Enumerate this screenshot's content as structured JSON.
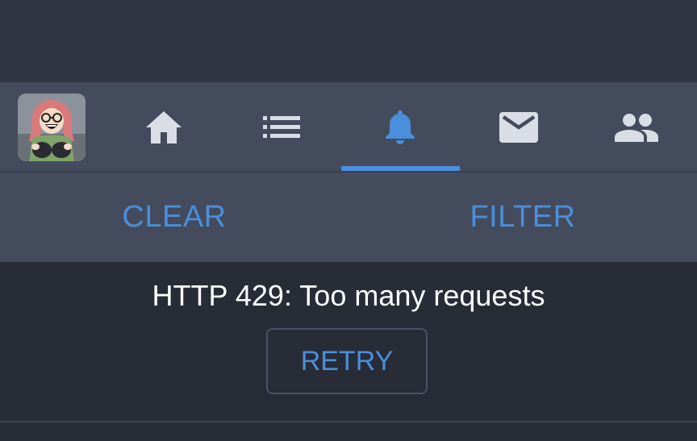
{
  "colors": {
    "accent": "#4a8fdb",
    "nav_background": "#444b5d",
    "page_background": "#282c37",
    "icon_default": "#d9dde6",
    "error_text": "#ffffff"
  },
  "navigation": {
    "active_tab": "notifications",
    "tabs": [
      {
        "id": "home",
        "icon": "home-icon",
        "active": false
      },
      {
        "id": "lists",
        "icon": "list-icon",
        "active": false
      },
      {
        "id": "notifications",
        "icon": "bell-icon",
        "active": true
      },
      {
        "id": "messages",
        "icon": "envelope-icon",
        "active": false
      },
      {
        "id": "people",
        "icon": "people-icon",
        "active": false
      }
    ]
  },
  "actions": {
    "clear_label": "CLEAR",
    "filter_label": "FILTER"
  },
  "error": {
    "message": "HTTP 429: Too many requests",
    "retry_label": "RETRY"
  }
}
